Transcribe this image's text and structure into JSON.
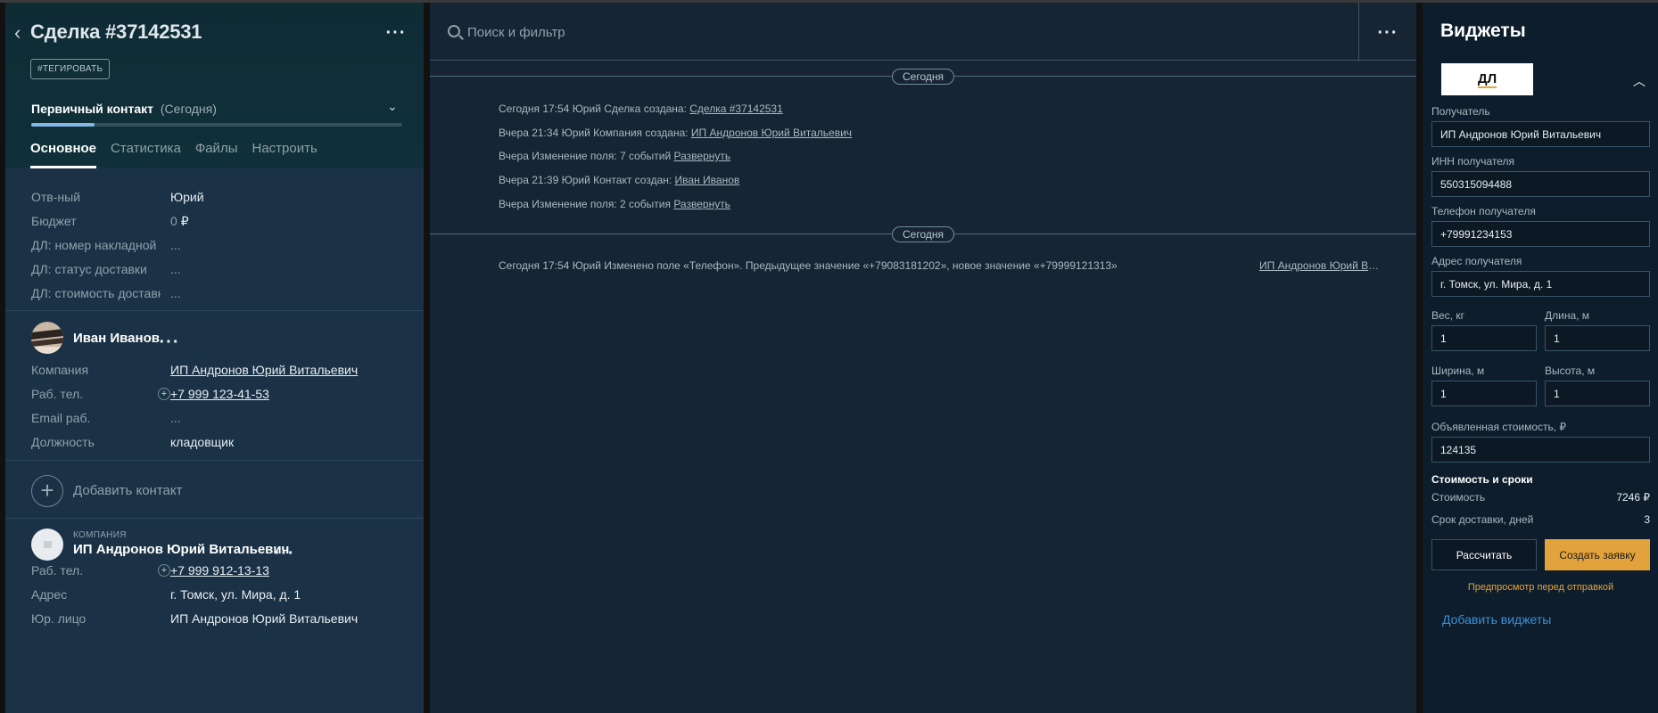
{
  "deal": {
    "title": "Сделка #37142531",
    "tag_label": "#ТЕГИРОВАТЬ",
    "stage_name": "Первичный контакт",
    "stage_when": "(Сегодня)",
    "stage_progress": 0.17,
    "tabs": [
      "Основное",
      "Статистика",
      "Файлы",
      "Настроить"
    ],
    "active_tab": 0,
    "fields": [
      {
        "label": "Отв-ный",
        "value": "Юрий"
      },
      {
        "label": "Бюджет",
        "value_num": "0",
        "currency": "₽"
      },
      {
        "label": "ДЛ: номер накладной",
        "value": "..."
      },
      {
        "label": "ДЛ: статус доставки",
        "value": "..."
      },
      {
        "label": "ДЛ: стоимость доставки",
        "value": "..."
      }
    ]
  },
  "contact": {
    "name": "Иван Иванов",
    "fields": [
      {
        "label": "Компания",
        "value": "ИП Андронов Юрий Витальевич"
      },
      {
        "label": "Раб. тел.",
        "value": "+7 999 123-41-53"
      },
      {
        "label": "Email раб.",
        "value": "..."
      },
      {
        "label": "Должность",
        "value": "кладовщик"
      }
    ],
    "add_label": "Добавить контакт"
  },
  "company": {
    "kind": "КОМПАНИЯ",
    "name": "ИП Андронов Юрий Витальевич",
    "fields": [
      {
        "label": "Раб. тел.",
        "value": "+7 999 912-13-13"
      },
      {
        "label": "Адрес",
        "value": "г. Томск, ул. Мира, д. 1"
      },
      {
        "label": "Юр. лицо",
        "value": "ИП Андронов Юрий Витальевич"
      }
    ]
  },
  "feed": {
    "search_placeholder": "Поиск и фильтр",
    "day_label_1": "Сегодня",
    "day_label_2": "Сегодня",
    "events": [
      {
        "text": "Сегодня 17:54 Юрий Сделка создана: ",
        "link": "Сделка #37142531"
      },
      {
        "text": "Вчера 21:34 Юрий Компания создана: ",
        "link": "ИП Андронов Юрий Витальевич"
      },
      {
        "text": "Вчера Изменение поля: 7 событий ",
        "link": "Развернуть"
      },
      {
        "text": "Вчера 21:39 Юрий Контакт создан: ",
        "link": "Иван Иванов"
      },
      {
        "text": "Вчера Изменение поля: 2 события ",
        "link": "Развернуть"
      }
    ],
    "change_event": {
      "text": "Сегодня 17:54 Юрий Изменено поле «Телефон». Предыдущее значение «+79083181202», новое значение «+79999121313»",
      "link": "ИП Андронов Юрий Витальевич"
    }
  },
  "widgets": {
    "title": "Виджеты",
    "logo_text": "ДЛ",
    "recipient_label": "Получатель",
    "recipient_value": "ИП Андронов Юрий Витальевич",
    "inn_label": "ИНН получателя",
    "inn_value": "550315094488",
    "phone_label": "Телефон получателя",
    "phone_value": "+79991234153",
    "address_label": "Адрес получателя",
    "address_value": "г. Томск, ул. Мира, д. 1",
    "weight_label": "Вес, кг",
    "weight_value": "1",
    "length_label": "Длина, м",
    "length_value": "1",
    "width_label": "Ширина, м",
    "width_value": "1",
    "height_label": "Высота, м",
    "height_value": "1",
    "declared_label": "Объявленная стоимость, ₽",
    "declared_value": "124135",
    "cost_section": "Стоимость и сроки",
    "cost_label": "Стоимость",
    "cost_value": "7246 ₽",
    "days_label": "Срок доставки, дней",
    "days_value": "3",
    "calc_button": "Рассчитать",
    "create_button": "Создать заявку",
    "preview_link": "Предпросмотр перед отправкой",
    "add_widgets": "Добавить виджеты"
  },
  "colors": {
    "accent": "#e3a33c",
    "link_blue": "#3e8fd4",
    "progress": "#84b6e6"
  }
}
